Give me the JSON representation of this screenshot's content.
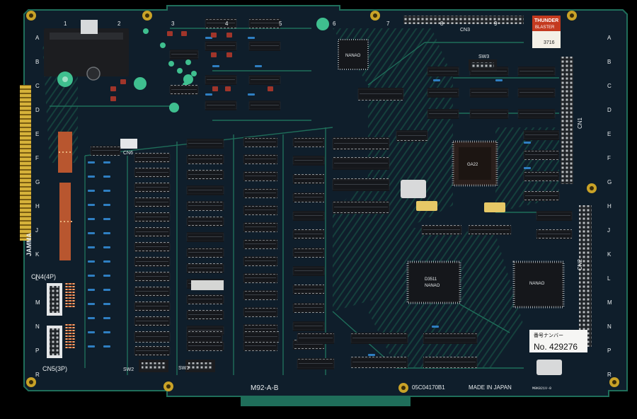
{
  "photo": {
    "subject": "printed-circuit-board",
    "colors": {
      "background": "#000000",
      "board": "#0f1e2b",
      "trace": "#1f6e5a",
      "chip": "#15171b",
      "silkscreen": "#e8ecee",
      "brass": "#c9a227",
      "header": "#c9c9c9",
      "resistor_pack": "#b8562f",
      "cap_blue": "#2f7fc2",
      "cap_green": "#3fbf8f",
      "cap_brown": "#a0352a"
    }
  },
  "silkscreen": {
    "jamma": "JAMMA",
    "cn4": "CN4(4P)",
    "cn5": "CN5(3P)",
    "cn3": "CN3",
    "cn2": "CN2",
    "cn1": "CN1",
    "cn6": "CN6",
    "sw1": "SW1",
    "sw2": "SW2",
    "sw3": "SW3",
    "board_id": "M92-A-B",
    "part_no": "05C04170B1",
    "made_in": "MADE IN JAPAN",
    "small_code": "M0K021V-0",
    "column_numbers": [
      "1",
      "2",
      "3",
      "4",
      "5",
      "6",
      "7",
      "8",
      "9",
      "10"
    ],
    "row_letters_left": [
      "A",
      "B",
      "C",
      "D",
      "E",
      "F",
      "G",
      "H",
      "J",
      "K",
      "L",
      "M",
      "N",
      "P",
      "R"
    ],
    "row_letters_right": [
      "A",
      "B",
      "C",
      "D",
      "E",
      "F",
      "G",
      "H",
      "J",
      "K",
      "L",
      "M",
      "N",
      "P",
      "R"
    ]
  },
  "stickers": {
    "thunder_line1": "THUNDER",
    "thunder_line2": "BLASTER",
    "thunder_serial": "3716",
    "serial_label": "番号ナンバー",
    "serial_number": "No. 429276"
  },
  "chips": {
    "cpu_top": "NANAO",
    "cpu_mid_line1": "D3511",
    "cpu_mid_line2": "NANAO",
    "cpu_right": "NANAO",
    "plcc": "GA22"
  }
}
